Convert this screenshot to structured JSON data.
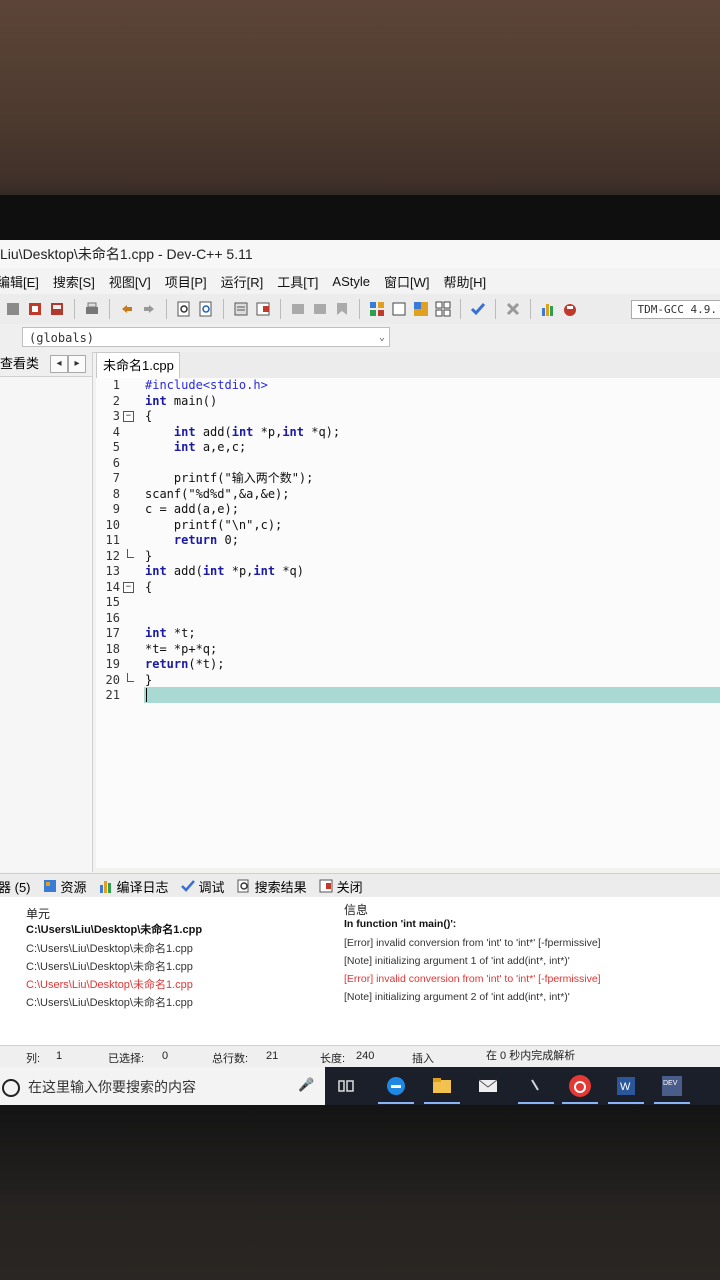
{
  "window": {
    "title": "Liu\\Desktop\\未命名1.cpp - Dev-C++ 5.11"
  },
  "menu": [
    "编辑[E]",
    "搜索[S]",
    "视图[V]",
    "项目[P]",
    "运行[R]",
    "工具[T]",
    "AStyle",
    "窗口[W]",
    "帮助[H]"
  ],
  "toolbar": {
    "compiler": "TDM-GCC 4.9."
  },
  "scope": {
    "value": "(globals)"
  },
  "left_panel": {
    "title": "查看类"
  },
  "editor": {
    "tab": "未命名1.cpp",
    "lines": [
      {
        "n": "1",
        "text": "#include<stdio.h>"
      },
      {
        "n": "2",
        "text": "int main()"
      },
      {
        "n": "3",
        "text": "{"
      },
      {
        "n": "4",
        "text": "    int add(int *p,int *q);"
      },
      {
        "n": "5",
        "text": "    int a,e,c;"
      },
      {
        "n": "6",
        "text": ""
      },
      {
        "n": "7",
        "text": "    printf(\"输入两个数\");"
      },
      {
        "n": "8",
        "text": "scanf(\"%d%d\",&a,&e);"
      },
      {
        "n": "9",
        "text": "c = add(a,e);"
      },
      {
        "n": "10",
        "text": "    printf(\"\\n\",c);"
      },
      {
        "n": "11",
        "text": "    return 0;"
      },
      {
        "n": "12",
        "text": "}"
      },
      {
        "n": "13",
        "text": "int add(int *p,int *q)"
      },
      {
        "n": "14",
        "text": "{"
      },
      {
        "n": "15",
        "text": ""
      },
      {
        "n": "16",
        "text": ""
      },
      {
        "n": "17",
        "text": "int *t;"
      },
      {
        "n": "18",
        "text": "*t= *p+*q;"
      },
      {
        "n": "19",
        "text": "return(*t);"
      },
      {
        "n": "20",
        "text": "}"
      },
      {
        "n": "21",
        "text": ""
      }
    ]
  },
  "bottom_tabs": [
    "器 (5)",
    "资源",
    "编译日志",
    "调试",
    "搜索结果",
    "关闭"
  ],
  "messages": {
    "col_unit": "单元",
    "col_info": "信息",
    "rows": [
      {
        "unit": "C:\\Users\\Liu\\Desktop\\未命名1.cpp",
        "info": "In function 'int main()':",
        "style": "bold"
      },
      {
        "unit": "C:\\Users\\Liu\\Desktop\\未命名1.cpp",
        "info": "[Error] invalid conversion from 'int' to 'int*' [-fpermissive]",
        "style": "normal"
      },
      {
        "unit": "C:\\Users\\Liu\\Desktop\\未命名1.cpp",
        "info": "[Note] initializing argument 1 of 'int add(int*, int*)'",
        "style": "normal"
      },
      {
        "unit": "C:\\Users\\Liu\\Desktop\\未命名1.cpp",
        "info": "[Error] invalid conversion from 'int' to 'int*' [-fpermissive]",
        "style": "error"
      },
      {
        "unit": "C:\\Users\\Liu\\Desktop\\未命名1.cpp",
        "info": "[Note] initializing argument 2 of 'int add(int*, int*)'",
        "style": "normal"
      }
    ]
  },
  "status": {
    "col_label": "列:",
    "col_value": "1",
    "selected_label": "已选择:",
    "selected_value": "0",
    "lines_label": "总行数:",
    "lines_value": "21",
    "length_label": "长度:",
    "length_value": "240",
    "mode": "插入",
    "parse": "在 0 秒内完成解析"
  },
  "taskbar": {
    "search_placeholder": "在这里输入你要搜索的内容"
  },
  "colors": {
    "keyword": "#1a1aa6",
    "current_line": "#a9d9d2",
    "error": "#e03535"
  }
}
